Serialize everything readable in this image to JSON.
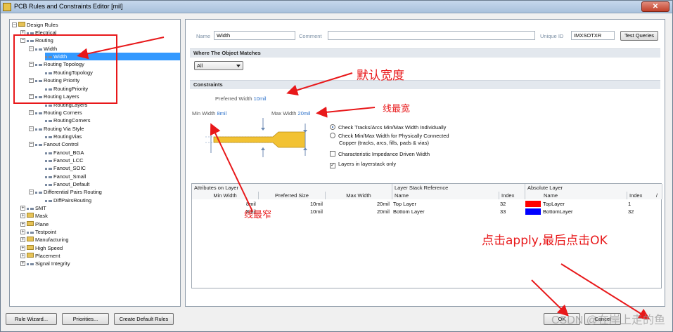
{
  "window": {
    "title": "PCB Rules and Constraints Editor [mil]",
    "close_glyph": "✕"
  },
  "tree": {
    "items": [
      {
        "label": "Design Rules",
        "exp": "−"
      },
      {
        "label": "Electrical",
        "exp": "+"
      },
      {
        "label": "Routing",
        "exp": "−"
      },
      {
        "label": "Width",
        "exp": "−"
      },
      {
        "label": "Width",
        "exp": ""
      },
      {
        "label": "Routing Topology",
        "exp": "−"
      },
      {
        "label": "RoutingTopology",
        "exp": ""
      },
      {
        "label": "Routing Priority",
        "exp": "−"
      },
      {
        "label": "RoutingPriority",
        "exp": ""
      },
      {
        "label": "Routing Layers",
        "exp": "−"
      },
      {
        "label": "RoutingLayers",
        "exp": ""
      },
      {
        "label": "Routing Corners",
        "exp": "−"
      },
      {
        "label": "RoutingCorners",
        "exp": ""
      },
      {
        "label": "Routing Via Style",
        "exp": "−"
      },
      {
        "label": "RoutingVias",
        "exp": ""
      },
      {
        "label": "Fanout Control",
        "exp": "−"
      },
      {
        "label": "Fanout_BGA",
        "exp": ""
      },
      {
        "label": "Fanout_LCC",
        "exp": ""
      },
      {
        "label": "Fanout_SOIC",
        "exp": ""
      },
      {
        "label": "Fanout_Small",
        "exp": ""
      },
      {
        "label": "Fanout_Default",
        "exp": ""
      },
      {
        "label": "Differential Pairs Routing",
        "exp": "−"
      },
      {
        "label": "DiffPairsRouting",
        "exp": ""
      },
      {
        "label": "SMT",
        "exp": "+"
      },
      {
        "label": "Mask",
        "exp": "+"
      },
      {
        "label": "Plane",
        "exp": "+"
      },
      {
        "label": "Testpoint",
        "exp": "+"
      },
      {
        "label": "Manufacturing",
        "exp": "+"
      },
      {
        "label": "High Speed",
        "exp": "+"
      },
      {
        "label": "Placement",
        "exp": "+"
      },
      {
        "label": "Signal Integrity",
        "exp": "+"
      }
    ]
  },
  "rule": {
    "name_label": "Name",
    "name_value": "Width",
    "comment_label": "Comment",
    "comment_value": "",
    "unique_id_label": "Unique ID",
    "unique_id_value": "IMXSOTXR",
    "test_queries_label": "Test Queries"
  },
  "where": {
    "header": "Where The Object Matches",
    "selected": "All"
  },
  "constraints": {
    "header": "Constraints",
    "preferred_label": "Preferred Width",
    "preferred_value": "10mil",
    "min_label": "Min Width",
    "min_value": "8mil",
    "max_label": "Max Width",
    "max_value": "20mil",
    "options": [
      {
        "label": "Check Tracks/Arcs Min/Max Width Individually",
        "checked": true
      },
      {
        "label": "Check Min/Max Width for Physically Connected",
        "checked": false
      },
      {
        "label": "Copper (tracks, arcs, fills, pads & vias)",
        "checked": false
      }
    ],
    "char_impedance_label": "Characteristic Impedance Driven Width",
    "char_impedance_checked": false,
    "layerstack_label": "Layers in layerstack only",
    "layerstack_checked": true,
    "check_glyph": "✓"
  },
  "table": {
    "group_headers": [
      "Attributes on Layer",
      "Layer Stack Reference",
      "Absolute Layer"
    ],
    "columns": [
      "Min Width",
      "Preferred Size",
      "Max Width",
      "Name",
      "Index",
      "Name",
      "Index"
    ],
    "sort_glyph": "/",
    "rows": [
      {
        "min": "8mil",
        "preferred": "10mil",
        "max": "20mil",
        "stack_name": "Top Layer",
        "stack_index": "32",
        "color": "#ff0000",
        "abs_name": "TopLayer",
        "abs_index": "1"
      },
      {
        "min": "8mil",
        "preferred": "10mil",
        "max": "20mil",
        "stack_name": "Bottom Layer",
        "stack_index": "33",
        "color": "#0000ff",
        "abs_name": "BottomLayer",
        "abs_index": "32"
      }
    ]
  },
  "buttons": {
    "rule_wizard": "Rule Wizard...",
    "priorities": "Priorities...",
    "create_default": "Create Default Rules",
    "ok": "OK",
    "cancel": "Cancel"
  },
  "annotations": {
    "default_width": "默认宽度",
    "max_width": "线最宽",
    "min_width": "线最窄",
    "apply_ok": "点击apply,最后点击OK"
  },
  "watermark": "CSDN @在岸上走的鱼"
}
